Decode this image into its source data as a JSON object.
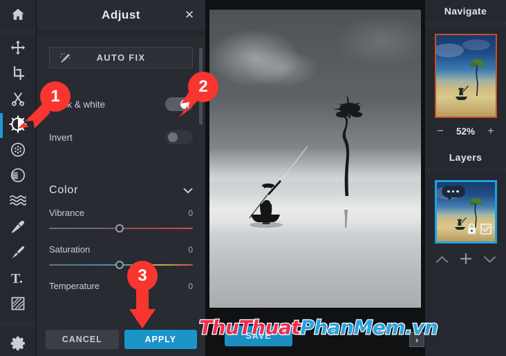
{
  "toolbar": {
    "items": [
      {
        "name": "home-icon",
        "label": "Home"
      },
      {
        "name": "move-icon",
        "label": "Move"
      },
      {
        "name": "crop-icon",
        "label": "Crop"
      },
      {
        "name": "cut-icon",
        "label": "Cut"
      },
      {
        "name": "adjust-icon",
        "label": "Adjust",
        "active": true
      },
      {
        "name": "effects-icon",
        "label": "Effects"
      },
      {
        "name": "gradient-icon",
        "label": "Gradient"
      },
      {
        "name": "distort-icon",
        "label": "Distort"
      },
      {
        "name": "retouch-icon",
        "label": "Retouch"
      },
      {
        "name": "brush-icon",
        "label": "Brush"
      },
      {
        "name": "text-icon",
        "label": "Text"
      },
      {
        "name": "texture-icon",
        "label": "Texture"
      },
      {
        "name": "settings-icon",
        "label": "Settings"
      }
    ]
  },
  "panel": {
    "title": "Adjust",
    "close_label": "✕",
    "autofix_label": "AUTO FIX",
    "toggles": [
      {
        "label": "Black & white",
        "state": "on"
      },
      {
        "label": "Invert",
        "state": "off"
      }
    ],
    "section": {
      "title": "Color",
      "chevron": "⌄",
      "sliders": [
        {
          "label": "Vibrance",
          "value": "0"
        },
        {
          "label": "Saturation",
          "value": "0"
        },
        {
          "label": "Temperature",
          "value": "0"
        }
      ]
    },
    "cancel_label": "CANCEL",
    "apply_label": "APPLY"
  },
  "canvas": {
    "save_label": "SAVE"
  },
  "right_panel": {
    "navigate_title": "Navigate",
    "zoom_out_label": "−",
    "zoom_value": "52%",
    "zoom_in_label": "+",
    "layers_title": "Layers",
    "layer_menu_dots": "",
    "layer_up_label": "∧",
    "layer_add_label": "+",
    "layer_down_label": "∨",
    "expand_label": "›"
  },
  "markers": [
    {
      "number": "1"
    },
    {
      "number": "2"
    },
    {
      "number": "3"
    }
  ],
  "watermark": {
    "part1": "ThuThuat",
    "part2": "PhanMem",
    "part3": ".vn"
  },
  "colors": {
    "accent_blue": "#1b94c9",
    "marker_red": "#f9352f",
    "selection_blue": "#1fa3e0",
    "navigate_border": "#c8502a"
  }
}
